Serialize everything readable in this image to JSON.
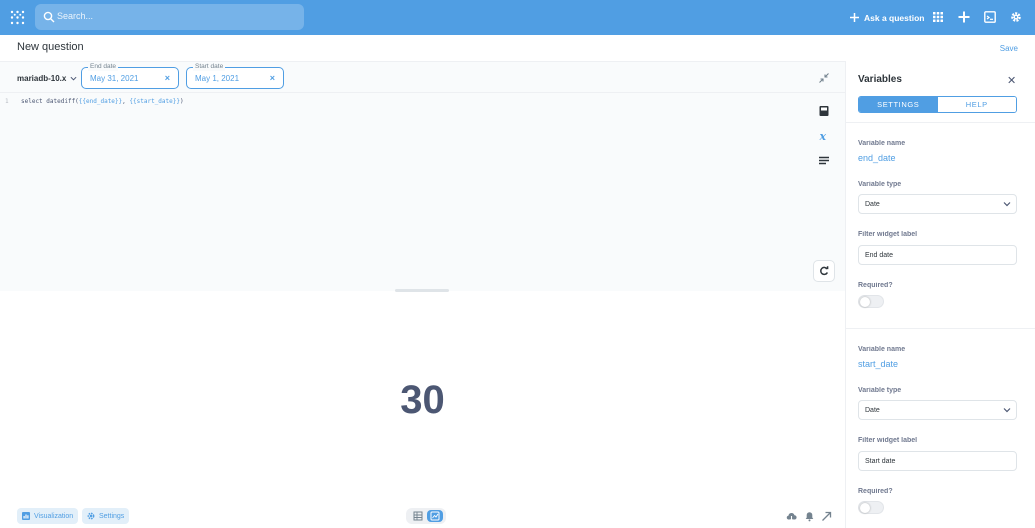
{
  "nav": {
    "search_placeholder": "Search...",
    "ask_label": "Ask a question"
  },
  "header": {
    "title": "New question",
    "save_label": "Save"
  },
  "editor": {
    "database": "mariadb-10.x",
    "params": [
      {
        "label": "End date",
        "value": "May 31, 2021"
      },
      {
        "label": "Start date",
        "value": "May 1, 2021"
      }
    ],
    "line_number": "1",
    "code_prefix": "select datediff(",
    "code_var1": "{{end_date}}",
    "code_mid": ", ",
    "code_var2": "{{start_date}}",
    "code_suffix": ")"
  },
  "result": {
    "value": "30"
  },
  "footer": {
    "visualization_label": "Visualization",
    "settings_label": "Settings"
  },
  "panel": {
    "title": "Variables",
    "tabs": [
      {
        "label": "SETTINGS"
      },
      {
        "label": "HELP"
      }
    ],
    "variables": [
      {
        "name_label": "Variable name",
        "name": "end_date",
        "type_label": "Variable type",
        "type": "Date",
        "widget_label_caption": "Filter widget label",
        "widget_label": "End date",
        "required_label": "Required?"
      },
      {
        "name_label": "Variable name",
        "name": "start_date",
        "type_label": "Variable type",
        "type": "Date",
        "widget_label_caption": "Filter widget label",
        "widget_label": "Start date",
        "required_label": "Required?"
      }
    ]
  },
  "colors": {
    "brand": "#509ee3",
    "text": "#4c5773"
  }
}
